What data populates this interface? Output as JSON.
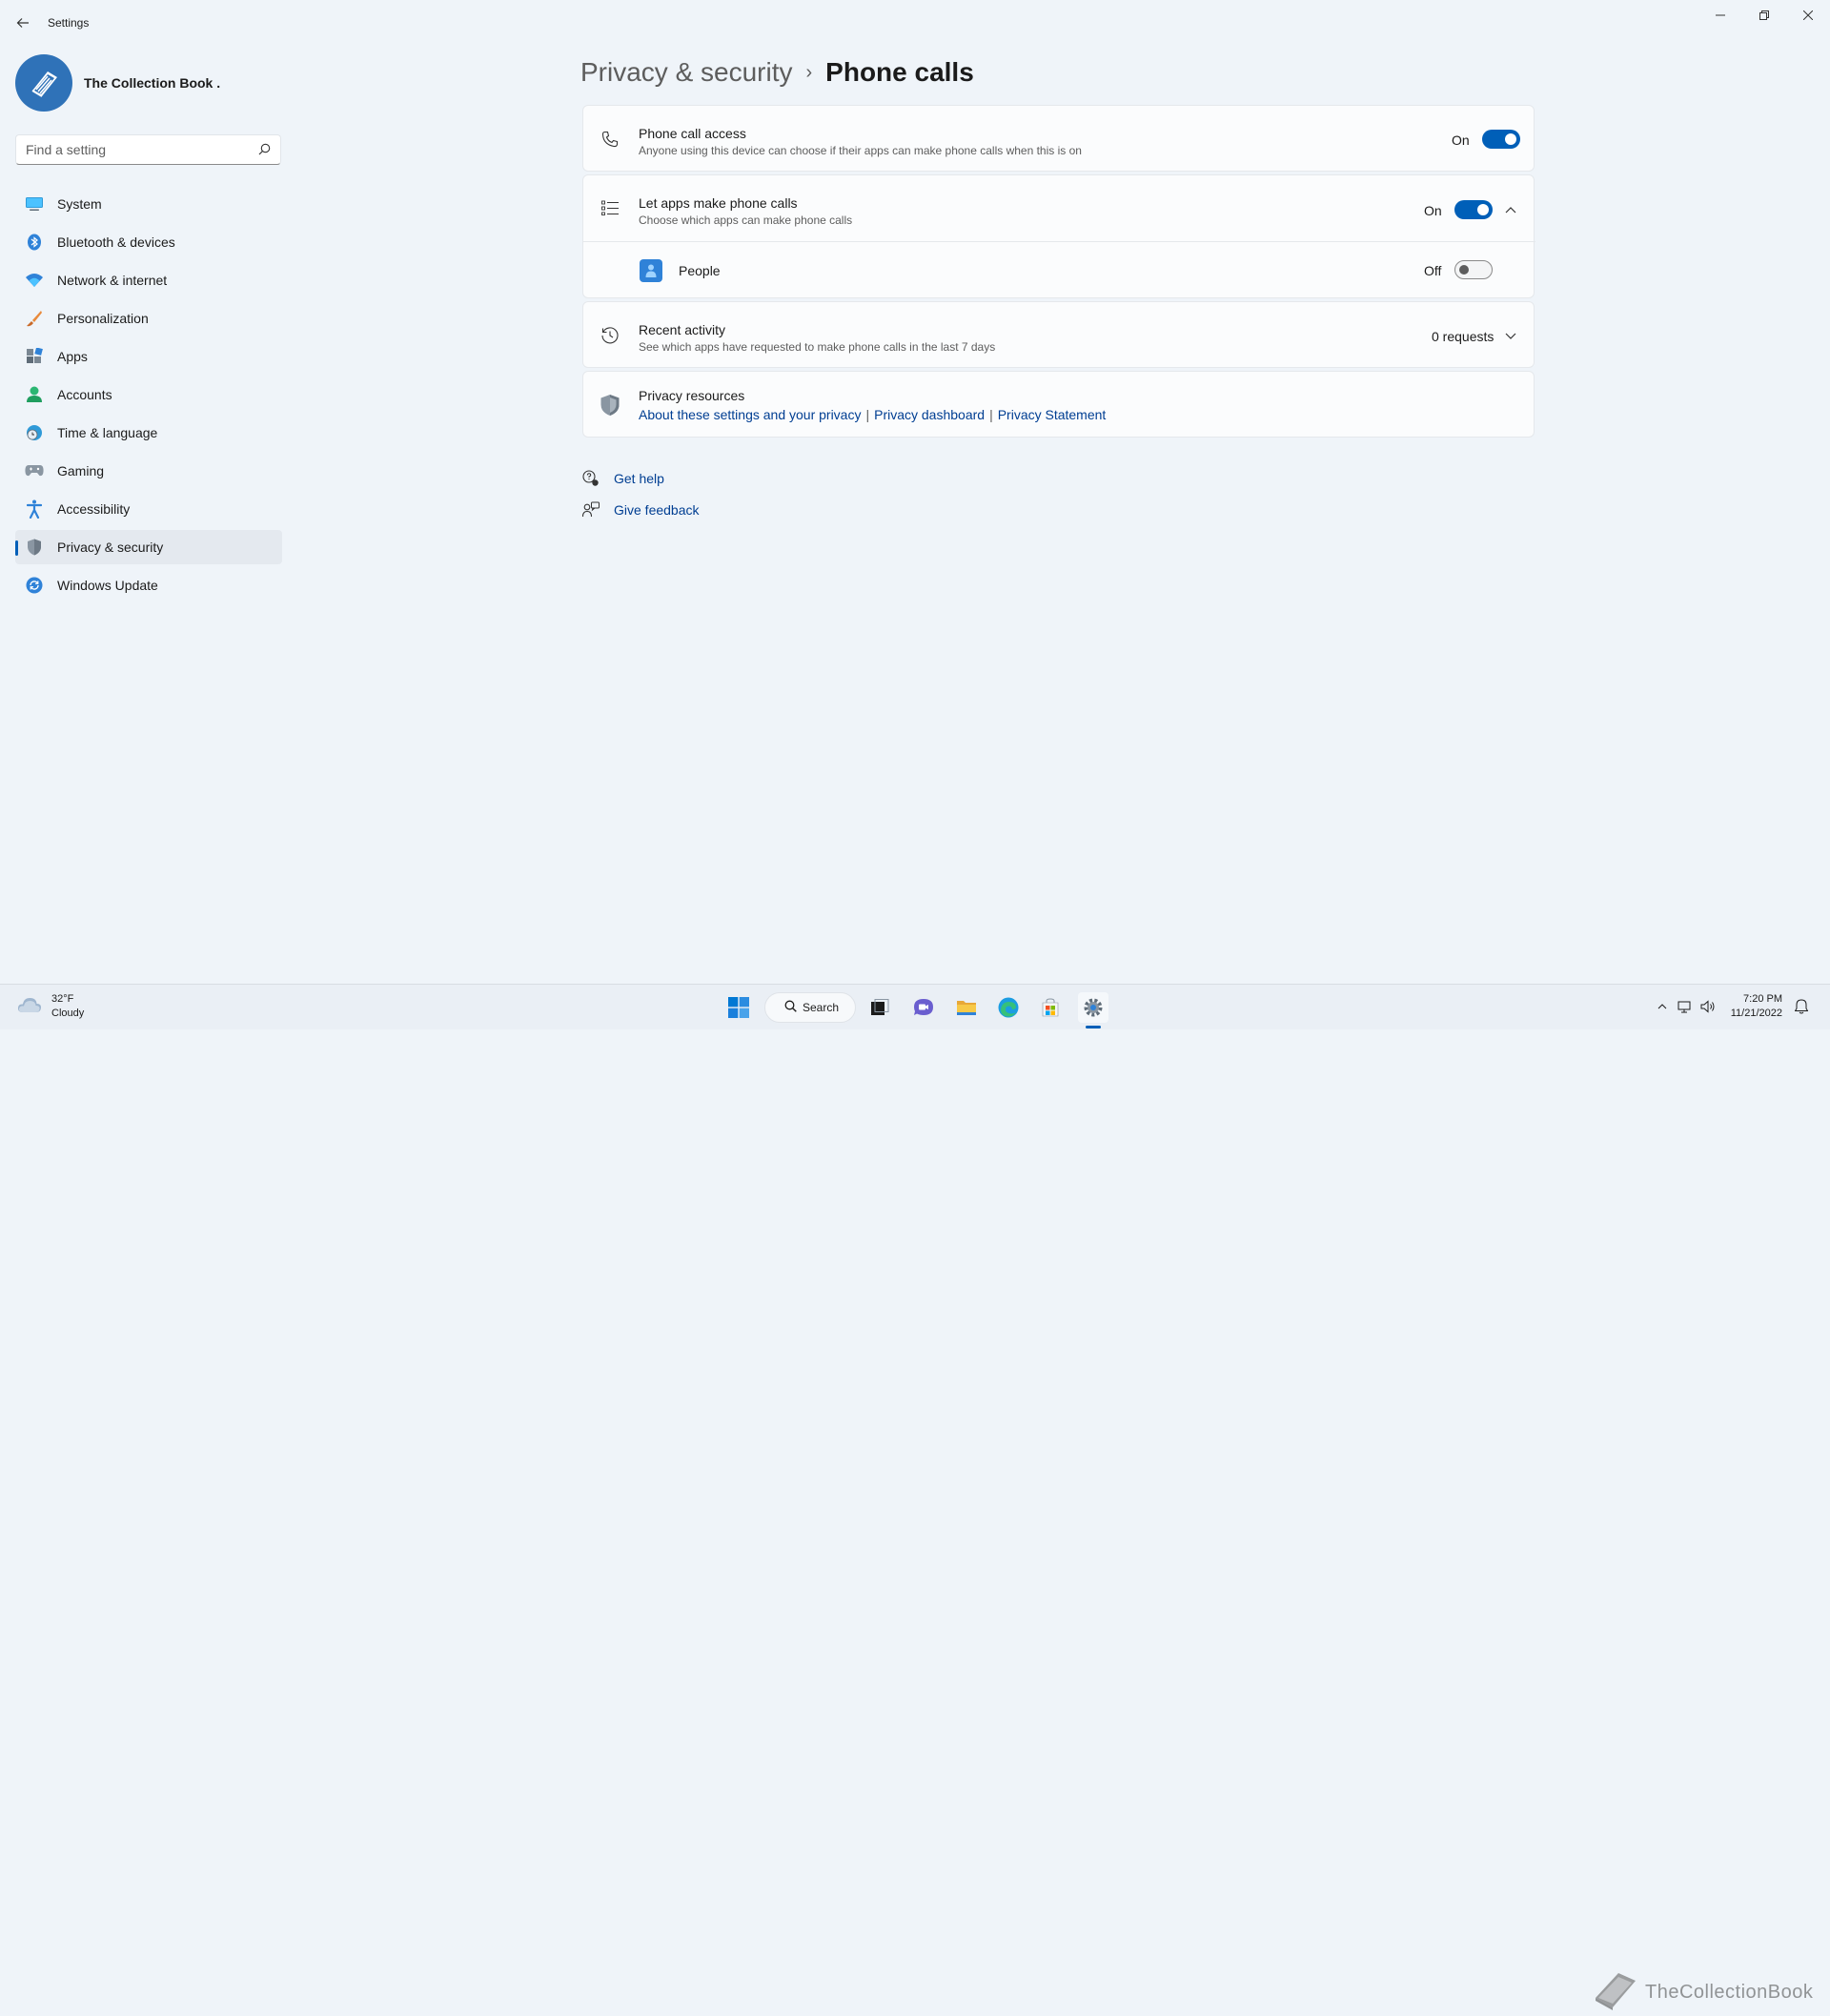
{
  "app": {
    "title": "Settings"
  },
  "profile": {
    "name": "The Collection Book ."
  },
  "search": {
    "placeholder": "Find a setting"
  },
  "sidebar": {
    "items": [
      {
        "label": "System",
        "icon": "monitor-icon"
      },
      {
        "label": "Bluetooth & devices",
        "icon": "bluetooth-icon"
      },
      {
        "label": "Network & internet",
        "icon": "wifi-icon"
      },
      {
        "label": "Personalization",
        "icon": "brush-icon"
      },
      {
        "label": "Apps",
        "icon": "apps-icon"
      },
      {
        "label": "Accounts",
        "icon": "person-icon"
      },
      {
        "label": "Time & language",
        "icon": "globe-clock-icon"
      },
      {
        "label": "Gaming",
        "icon": "gamepad-icon"
      },
      {
        "label": "Accessibility",
        "icon": "accessibility-icon"
      },
      {
        "label": "Privacy & security",
        "icon": "shield-icon",
        "active": true
      },
      {
        "label": "Windows Update",
        "icon": "update-icon"
      }
    ]
  },
  "breadcrumb": {
    "parent": "Privacy & security",
    "separator": "›",
    "current": "Phone calls"
  },
  "settings": {
    "phone_access": {
      "title": "Phone call access",
      "description": "Anyone using this device can choose if their apps can make phone calls when this is on",
      "state": "On",
      "enabled": true
    },
    "let_apps": {
      "title": "Let apps make phone calls",
      "description": "Choose which apps can make phone calls",
      "state": "On",
      "enabled": true,
      "expanded": true,
      "apps": [
        {
          "name": "People",
          "state": "Off",
          "enabled": false
        }
      ]
    },
    "recent_activity": {
      "title": "Recent activity",
      "description": "See which apps have requested to make phone calls in the last 7 days",
      "value": "0 requests"
    },
    "privacy_resources": {
      "title": "Privacy resources",
      "links": [
        "About these settings and your privacy",
        "Privacy dashboard",
        "Privacy Statement"
      ]
    }
  },
  "help": {
    "get_help": "Get help",
    "give_feedback": "Give feedback"
  },
  "taskbar": {
    "weather": {
      "temp": "32°F",
      "condition": "Cloudy"
    },
    "search_label": "Search",
    "clock": {
      "time": "7:20 PM",
      "date": "11/21/2022"
    },
    "watermark": "TheCollectionBook"
  },
  "colors": {
    "accent": "#005fb8",
    "background": "#eff4f9",
    "card": "#fbfcfd"
  }
}
